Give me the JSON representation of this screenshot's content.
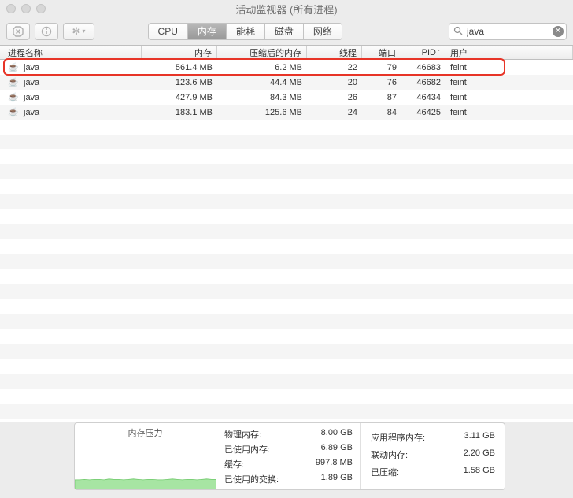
{
  "window": {
    "title": "活动监视器 (所有进程)"
  },
  "tabs": {
    "cpu": "CPU",
    "memory": "内存",
    "energy": "能耗",
    "disk": "磁盘",
    "network": "网络",
    "active": "memory"
  },
  "search": {
    "value": "java"
  },
  "columns": {
    "name": "进程名称",
    "memory": "内存",
    "compressed": "压缩后的内存",
    "threads": "线程",
    "ports": "端口",
    "pid": "PID",
    "user": "用户"
  },
  "processes": [
    {
      "name": "java",
      "memory": "561.4 MB",
      "compressed": "6.2 MB",
      "threads": "22",
      "ports": "79",
      "pid": "46683",
      "user": "feint"
    },
    {
      "name": "java",
      "memory": "123.6 MB",
      "compressed": "44.4 MB",
      "threads": "20",
      "ports": "76",
      "pid": "46682",
      "user": "feint"
    },
    {
      "name": "java",
      "memory": "427.9 MB",
      "compressed": "84.3 MB",
      "threads": "26",
      "ports": "87",
      "pid": "46434",
      "user": "feint"
    },
    {
      "name": "java",
      "memory": "183.1 MB",
      "compressed": "125.6 MB",
      "threads": "24",
      "ports": "84",
      "pid": "46425",
      "user": "feint"
    }
  ],
  "footer": {
    "pressure_title": "内存压力",
    "stats1": {
      "physical_label": "物理内存:",
      "physical_value": "8.00 GB",
      "used_label": "已使用内存:",
      "used_value": "6.89 GB",
      "cache_label": "缓存:",
      "cache_value": "997.8 MB",
      "swap_label": "已使用的交换:",
      "swap_value": "1.89 GB"
    },
    "stats2": {
      "app_label": "应用程序内存:",
      "app_value": "3.11 GB",
      "wired_label": "联动内存:",
      "wired_value": "2.20 GB",
      "compressed_label": "已压缩:",
      "compressed_value": "1.58 GB"
    }
  },
  "chart_data": {
    "type": "area",
    "title": "内存压力",
    "ylim": [
      0,
      1
    ],
    "x": [
      0,
      1,
      2,
      3,
      4,
      5,
      6,
      7,
      8,
      9,
      10,
      11,
      12,
      13,
      14,
      15,
      16,
      17,
      18,
      19,
      20,
      21,
      22,
      23,
      24,
      25,
      26,
      27,
      28,
      29
    ],
    "values": [
      0.22,
      0.22,
      0.23,
      0.22,
      0.23,
      0.23,
      0.22,
      0.24,
      0.23,
      0.23,
      0.22,
      0.23,
      0.24,
      0.23,
      0.22,
      0.23,
      0.23,
      0.22,
      0.22,
      0.23,
      0.24,
      0.23,
      0.22,
      0.23,
      0.23,
      0.22,
      0.23,
      0.24,
      0.23,
      0.23
    ],
    "color": "#a7e5a3"
  }
}
